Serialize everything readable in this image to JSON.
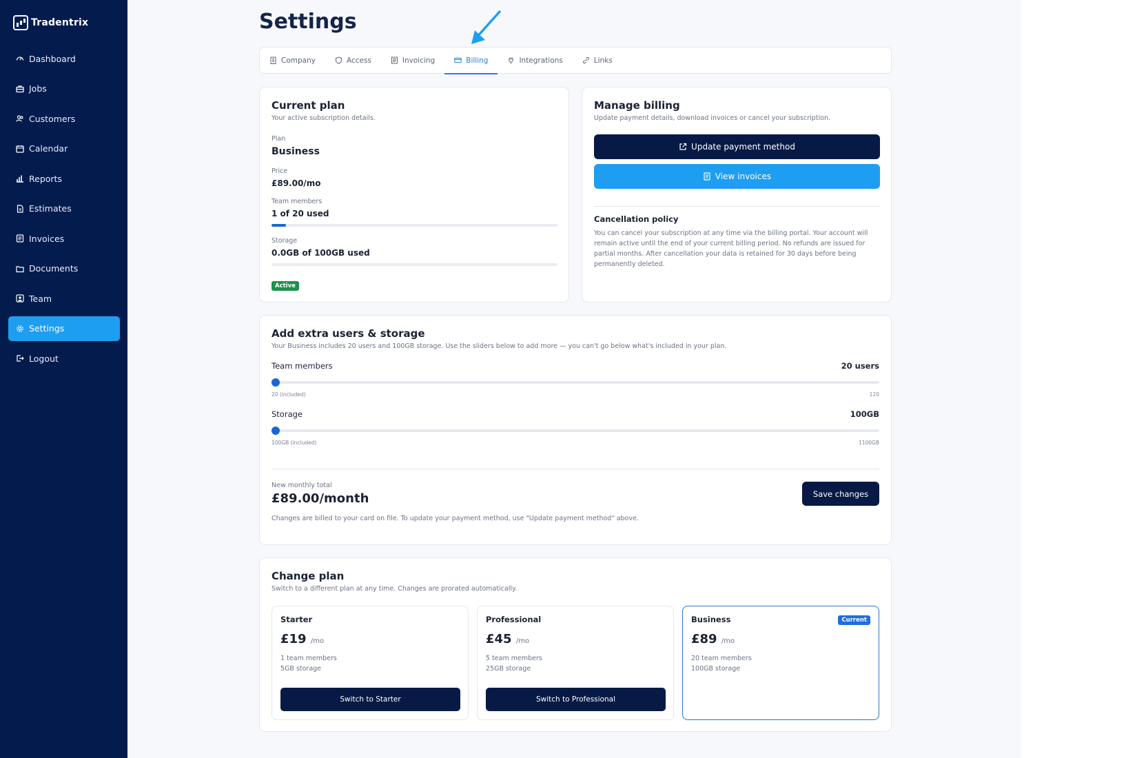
{
  "brand": {
    "name": "Tradentrix"
  },
  "sidebar": {
    "items": [
      {
        "label": "Dashboard",
        "icon": "gauge-icon"
      },
      {
        "label": "Jobs",
        "icon": "briefcase-icon"
      },
      {
        "label": "Customers",
        "icon": "users-icon"
      },
      {
        "label": "Calendar",
        "icon": "calendar-icon"
      },
      {
        "label": "Reports",
        "icon": "bar-chart-icon"
      },
      {
        "label": "Estimates",
        "icon": "file-icon"
      },
      {
        "label": "Invoices",
        "icon": "receipt-icon"
      },
      {
        "label": "Documents",
        "icon": "folder-icon"
      },
      {
        "label": "Team",
        "icon": "team-icon"
      },
      {
        "label": "Settings",
        "icon": "gear-icon",
        "active": true
      },
      {
        "label": "Logout",
        "icon": "logout-icon"
      }
    ]
  },
  "page": {
    "title": "Settings"
  },
  "tabs": [
    {
      "label": "Company",
      "icon": "building-icon"
    },
    {
      "label": "Access",
      "icon": "shield-icon"
    },
    {
      "label": "Invoicing",
      "icon": "document-icon"
    },
    {
      "label": "Billing",
      "icon": "credit-card-icon",
      "active": true
    },
    {
      "label": "Integrations",
      "icon": "plug-icon"
    },
    {
      "label": "Links",
      "icon": "link-icon"
    }
  ],
  "current_plan": {
    "title": "Current plan",
    "subtitle": "Your active subscription details.",
    "plan_label": "Plan",
    "plan_value": "Business",
    "price_label": "Price",
    "price_value": "£89.00/mo",
    "team_label": "Team members",
    "team_value": "1 of 20 used",
    "team_progress": 0.05,
    "storage_label": "Storage",
    "storage_value": "0.0GB of 100GB used",
    "storage_progress": 0.0,
    "status": "Active"
  },
  "manage_billing": {
    "title": "Manage billing",
    "subtitle": "Update payment details, download invoices or cancel your subscription.",
    "update_button": "Update payment method",
    "invoices_button": "View invoices",
    "policy_title": "Cancellation policy",
    "policy_text": "You can cancel your subscription at any time via the billing portal. Your account will remain active until the end of your current billing period. No refunds are issued for partial months. After cancellation your data is retained for 30 days before being permanently deleted."
  },
  "extra": {
    "title": "Add extra users & storage",
    "subtitle": "Your Business includes 20 users and 100GB storage. Use the sliders below to add more — you can't go below what's included in your plan.",
    "team": {
      "label": "Team members",
      "value": "20 users",
      "min_label": "20 (included)",
      "max_label": "120",
      "level": 0
    },
    "storage": {
      "label": "Storage",
      "value": "100GB",
      "min_label": "100GB (included)",
      "max_label": "1100GB",
      "level": 0
    },
    "total_label": "New monthly total",
    "total_value": "£89.00/month",
    "save_button": "Save changes",
    "note": "Changes are billed to your card on file. To update your payment method, use \"Update payment method\" above."
  },
  "change_plan": {
    "title": "Change plan",
    "subtitle": "Switch to a different plan at any time. Changes are prorated automatically.",
    "plans": [
      {
        "name": "Starter",
        "price": "£19",
        "per": "/mo",
        "members": "1 team members",
        "storage": "5GB storage",
        "button": "Switch to Starter"
      },
      {
        "name": "Professional",
        "price": "£45",
        "per": "/mo",
        "members": "5 team members",
        "storage": "25GB storage",
        "button": "Switch to Professional"
      },
      {
        "name": "Business",
        "price": "£89",
        "per": "/mo",
        "members": "20 team members",
        "storage": "100GB storage",
        "badge": "Current"
      }
    ]
  },
  "colors": {
    "sidebar": "#041b4d",
    "accent": "#1e9ef0",
    "primary_button": "#071a45",
    "active_badge": "#1e8f4e"
  }
}
